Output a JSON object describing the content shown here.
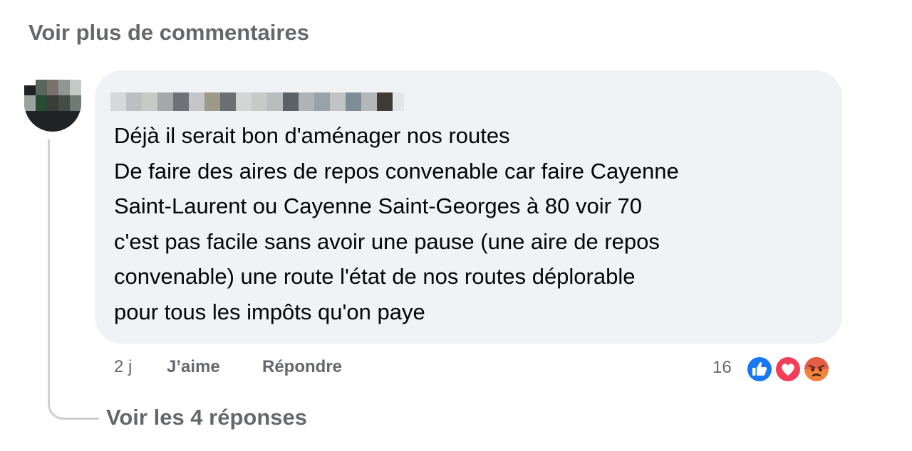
{
  "see_more_comments": "Voir plus de commentaires",
  "comment": {
    "lines": [
      "Déjà il serait bon d'aménager nos routes",
      "De faire des aires de repos convenable car faire Cayenne",
      "Saint-Laurent ou Cayenne Saint-Georges à 80 voir 70",
      "c'est pas facile sans avoir une pause (une aire de repos",
      "convenable) une route l'état de nos routes déplorable",
      "pour tous les impôts qu'on paye"
    ],
    "time": "2 j",
    "like_label": "J’aime",
    "reply_label": "Répondre",
    "reaction_count": "16",
    "reactions": [
      "like-icon",
      "love-icon",
      "angry-icon"
    ]
  },
  "see_replies": "Voir les 4 réponses",
  "colors": {
    "bubble": "#f0f2f5",
    "secondary_text": "#65676b",
    "like": "#1877f2",
    "love": "#f33e58",
    "angry": "#e9710f"
  }
}
